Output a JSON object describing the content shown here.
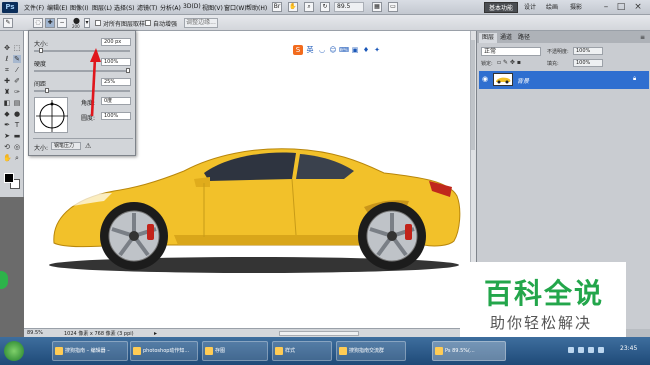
{
  "menubar": {
    "items": [
      "文件(F)",
      "编辑(E)",
      "图像(I)",
      "图层(L)",
      "选择(S)",
      "滤镜(T)",
      "分析(A)",
      "3D(D)",
      "视图(V)",
      "窗口(W)",
      "帮助(H)"
    ],
    "zoom": "89.5",
    "workspaces": [
      "基本功能",
      "设计",
      "绘画",
      "摄影"
    ],
    "window_controls": [
      "–",
      "□",
      "×"
    ]
  },
  "options": {
    "brush_size_value": "200",
    "checkbox_all_layers": "对所有图层取样",
    "checkbox_auto_enhance": "自动增强",
    "refine_button": "调整边缘..."
  },
  "brush_popup": {
    "size_label": "大小:",
    "size_value": "200 px",
    "hardness_label": "硬度",
    "hardness_value": "100%",
    "spacing_label": "间距",
    "spacing_value": "25%",
    "angle_label": "角度:",
    "angle_value": "0度",
    "roundness_label": "圆度:",
    "roundness_value": "100%",
    "pen_size_label": "大小:",
    "pen_size_value": "钢笔压力",
    "size_fill": 0.05,
    "hardness_fill": 1.0,
    "spacing_fill": 0.12
  },
  "floating_toolbar": {
    "logo": "S",
    "text": "英"
  },
  "status": {
    "zoom": "89.5%",
    "doc_info": "1024 像素 x 768 像素 (3 ppi)"
  },
  "layers_panel": {
    "tabs": [
      "图层",
      "通道",
      "路径"
    ],
    "blend_mode": "正常",
    "opacity_label": "不透明度:",
    "opacity_value": "100%",
    "lock_label": "锁定:",
    "fill_label": "填充:",
    "fill_value": "100%",
    "layer_name": "背景"
  },
  "taskbar": {
    "buttons": [
      "搜狗指南 – 编辑器 –",
      "photoshop动作知...",
      "存图",
      "样式",
      "搜狗指南交流群",
      "Ps 89.5%(..."
    ],
    "clock": "23:45"
  },
  "watermark": {
    "title": "百科全说",
    "subtitle": "助你轻松解决"
  },
  "colors": {
    "accent": "#2f6fd0",
    "car": "#f2c12a",
    "watermark_green": "#23a64b"
  }
}
